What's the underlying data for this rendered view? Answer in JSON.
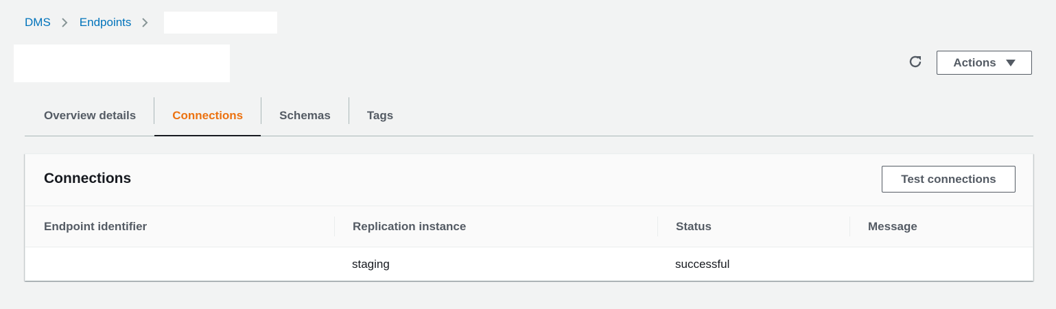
{
  "breadcrumb": {
    "items": [
      "DMS",
      "Endpoints"
    ],
    "current": ""
  },
  "header": {
    "title": "",
    "actions_label": "Actions"
  },
  "tabs": [
    {
      "label": "Overview details",
      "active": false
    },
    {
      "label": "Connections",
      "active": true
    },
    {
      "label": "Schemas",
      "active": false
    },
    {
      "label": "Tags",
      "active": false
    }
  ],
  "connections": {
    "title": "Connections",
    "test_button_label": "Test connections",
    "columns": [
      "Endpoint identifier",
      "Replication instance",
      "Status",
      "Message"
    ],
    "rows": [
      {
        "endpoint_identifier": "",
        "replication_instance": "staging",
        "status": "successful",
        "message": ""
      }
    ]
  },
  "colors": {
    "link": "#0073bb",
    "active_tab": "#ec7211",
    "background": "#f2f3f3",
    "button_text": "#545b64"
  }
}
